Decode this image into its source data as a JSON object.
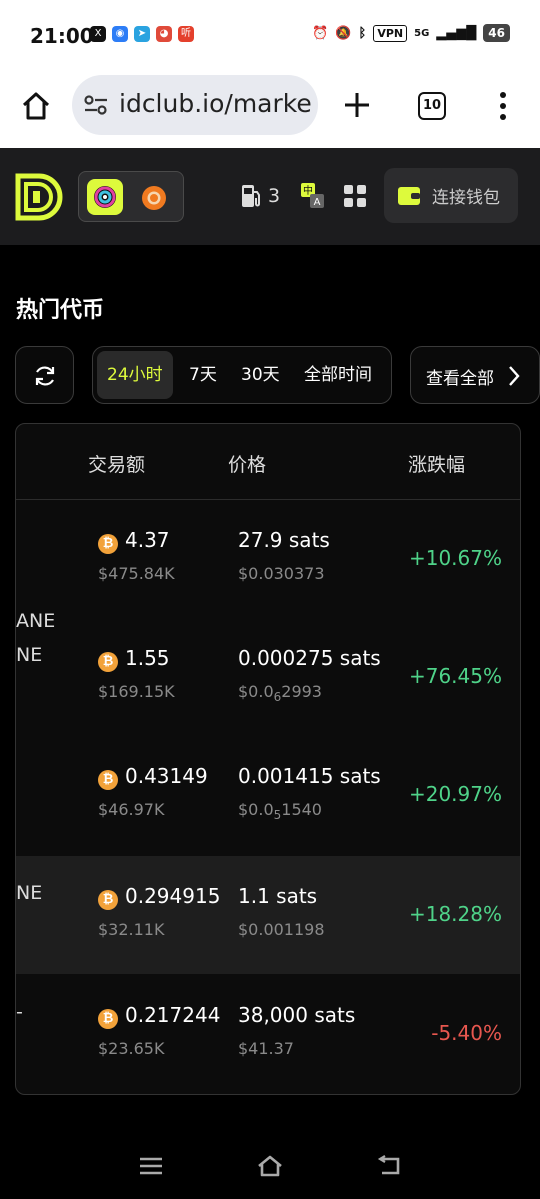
{
  "status_bar": {
    "time": "21:00",
    "network": "5G",
    "vpn": "VPN",
    "battery": "46"
  },
  "browser": {
    "url": "idclub.io/marke",
    "tab_count": "10"
  },
  "header": {
    "gas_count": "3",
    "connect_label": "连接钱包",
    "accent_color": "#ddfa3c"
  },
  "section": {
    "title": "热门代币",
    "filters": [
      "24小时",
      "7天",
      "30天",
      "全部时间"
    ],
    "active_filter": "24小时",
    "view_all": "查看全部"
  },
  "table": {
    "headers": [
      "交易额",
      "价格",
      "涨跌幅"
    ],
    "rows": [
      {
        "name": "ANE",
        "volume": "4.37",
        "volume_usd": "$475.84K",
        "price": "27.9 sats",
        "price_usd": "$0.030373",
        "change": "+10.67%",
        "direction": "up"
      },
      {
        "name": "NE",
        "volume": "1.55",
        "volume_usd": "$169.15K",
        "price": "0.000275 sats",
        "price_usd_prefix": "$0.0",
        "price_usd_sub": "6",
        "price_usd_rest": "2993",
        "change": "+76.45%",
        "direction": "up"
      },
      {
        "name": "",
        "volume": "0.43149",
        "volume_usd": "$46.97K",
        "price": "0.001415 sats",
        "price_usd_prefix": "$0.0",
        "price_usd_sub": "5",
        "price_usd_rest": "1540",
        "change": "+20.97%",
        "direction": "up"
      },
      {
        "name": "NE",
        "volume": "0.294915",
        "volume_usd": "$32.11K",
        "price": "1.1 sats",
        "price_usd": "$0.001198",
        "change": "+18.28%",
        "direction": "up"
      },
      {
        "name": "-",
        "volume": "0.217244",
        "volume_usd": "$23.65K",
        "price": "38,000 sats",
        "price_usd": "$41.37",
        "change": "-5.40%",
        "direction": "down"
      }
    ],
    "up_color": "#4fd389",
    "down_color": "#e8574f"
  }
}
